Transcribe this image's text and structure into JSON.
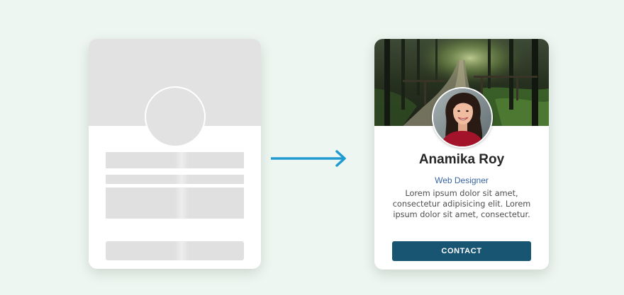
{
  "colors": {
    "page_background": "#edf6f0",
    "skeleton_fill": "#e2e2e2",
    "arrow": "#1f9bd1",
    "name_text": "#262626",
    "role_text": "#3a66a3",
    "bio_text": "#4e4e4e",
    "button_background": "#185573",
    "button_text": "#ffffff"
  },
  "skeleton_card": {
    "state": "loading placeholder"
  },
  "arrow": {
    "icon": "arrow-right-icon"
  },
  "profile_card": {
    "cover_image": "forest-path-photo",
    "avatar_image": "woman-portrait-photo",
    "name": "Anamika Roy",
    "role": "Web Designer",
    "bio": "Lorem ipsum dolor sit amet, consectetur adipisicing elit. Lorem ipsum dolor sit amet, consectetur.",
    "contact_label": "CONTACT"
  }
}
